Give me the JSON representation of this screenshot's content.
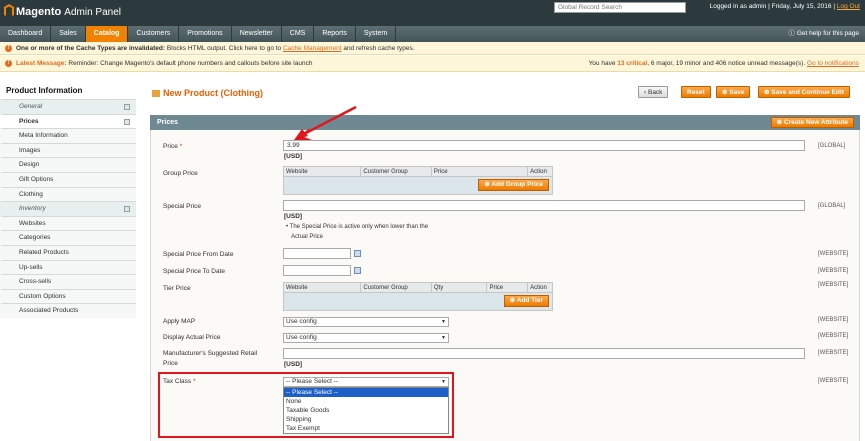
{
  "header": {
    "logo_brand": "Magento",
    "logo_subtitle": "Admin Panel",
    "search_placeholder": "Global Record Search",
    "logged_in": "Logged in as admin",
    "date": "Friday, July 15, 2016",
    "separator": "|",
    "logout": "Log Out"
  },
  "nav": {
    "items": [
      "Dashboard",
      "Sales",
      "Catalog",
      "Customers",
      "Promotions",
      "Newsletter",
      "CMS",
      "Reports",
      "System"
    ],
    "help": "Get help for this page"
  },
  "messages": {
    "cache_lead": "One or more of the Cache Types are invalidated:",
    "cache_text": "Blocks HTML output. Click here to go to",
    "cache_link": "Cache Management",
    "cache_tail": "and refresh cache types.",
    "latest_label": "Latest Message:",
    "latest_text": "Reminder: Change Magento's default phone numbers and callouts before site launch",
    "notice_pre": "You have",
    "notice_critical": "13 critical",
    "notice_mid": ", 6 major, 19 minor and 406 notice unread message(s).",
    "notice_link": "Go to notifications"
  },
  "sidebar": {
    "title": "Product Information",
    "items": [
      {
        "label": "General",
        "type": "section"
      },
      {
        "label": "Prices",
        "type": "active"
      },
      {
        "label": "Meta Information",
        "type": "item"
      },
      {
        "label": "Images",
        "type": "item"
      },
      {
        "label": "Design",
        "type": "item"
      },
      {
        "label": "Gift Options",
        "type": "item"
      },
      {
        "label": "Clothing",
        "type": "item"
      },
      {
        "label": "Inventory",
        "type": "section"
      },
      {
        "label": "Websites",
        "type": "item"
      },
      {
        "label": "Categories",
        "type": "item"
      },
      {
        "label": "Related Products",
        "type": "item"
      },
      {
        "label": "Up-sells",
        "type": "item"
      },
      {
        "label": "Cross-sells",
        "type": "item"
      },
      {
        "label": "Custom Options",
        "type": "item"
      },
      {
        "label": "Associated Products",
        "type": "item"
      }
    ]
  },
  "page": {
    "title": "New Product (Clothing)",
    "buttons": {
      "back": "Back",
      "reset": "Reset",
      "save": "Save",
      "save_continue": "Save and Continue Edit"
    },
    "section_title": "Prices",
    "create_attr": "Create New Attribute"
  },
  "form": {
    "price_label": "Price",
    "price_value": "3.99",
    "usd": "[USD]",
    "group_price_label": "Group Price",
    "group_cols": [
      "Website",
      "Customer Group",
      "Price",
      "Action"
    ],
    "add_group_price": "Add Group Price",
    "special_price_label": "Special Price",
    "special_note_1": "The Special Price is active only when lower than the",
    "special_note_2": "Actual Price",
    "special_from_label": "Special Price From Date",
    "special_to_label": "Special Price To Date",
    "tier_price_label": "Tier Price",
    "tier_cols": [
      "Website",
      "Customer Group",
      "Qty",
      "Price",
      "Action"
    ],
    "add_tier": "Add Tier",
    "apply_map_label": "Apply MAP",
    "apply_map_value": "Use config",
    "display_actual_label": "Display Actual Price",
    "display_actual_value": "Use config",
    "msrp_label_1": "Manufacturer's Suggested Retail",
    "msrp_label_2": "Price",
    "tax_class_label": "Tax Class",
    "tax_class_value": "-- Please Select --",
    "tax_options": [
      "-- Please Select --",
      "None",
      "Taxable Goods",
      "Shipping",
      "Tax Exempt"
    ],
    "scope_global": "[GLOBAL]",
    "scope_website": "[WEBSITE]"
  },
  "colors": {
    "accent": "#eb5e00",
    "highlight_box": "#e0171c",
    "arrow": "#e0171c"
  }
}
